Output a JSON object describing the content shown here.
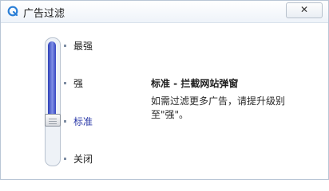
{
  "window": {
    "title": "广告过滤",
    "close_glyph": "✕"
  },
  "slider": {
    "level_index": 2,
    "levels": [
      {
        "label": "最强"
      },
      {
        "label": "强"
      },
      {
        "label": "标准"
      },
      {
        "label": "关闭"
      }
    ]
  },
  "description": {
    "title": "标准 - 拦截网站弹窗",
    "text": "如需过滤更多广告，请提升级别至\"强\"。"
  },
  "colors": {
    "accent": "#2b3aa8",
    "track_fill": "#4a5ad0",
    "title_gradient_top": "#ffffff"
  }
}
